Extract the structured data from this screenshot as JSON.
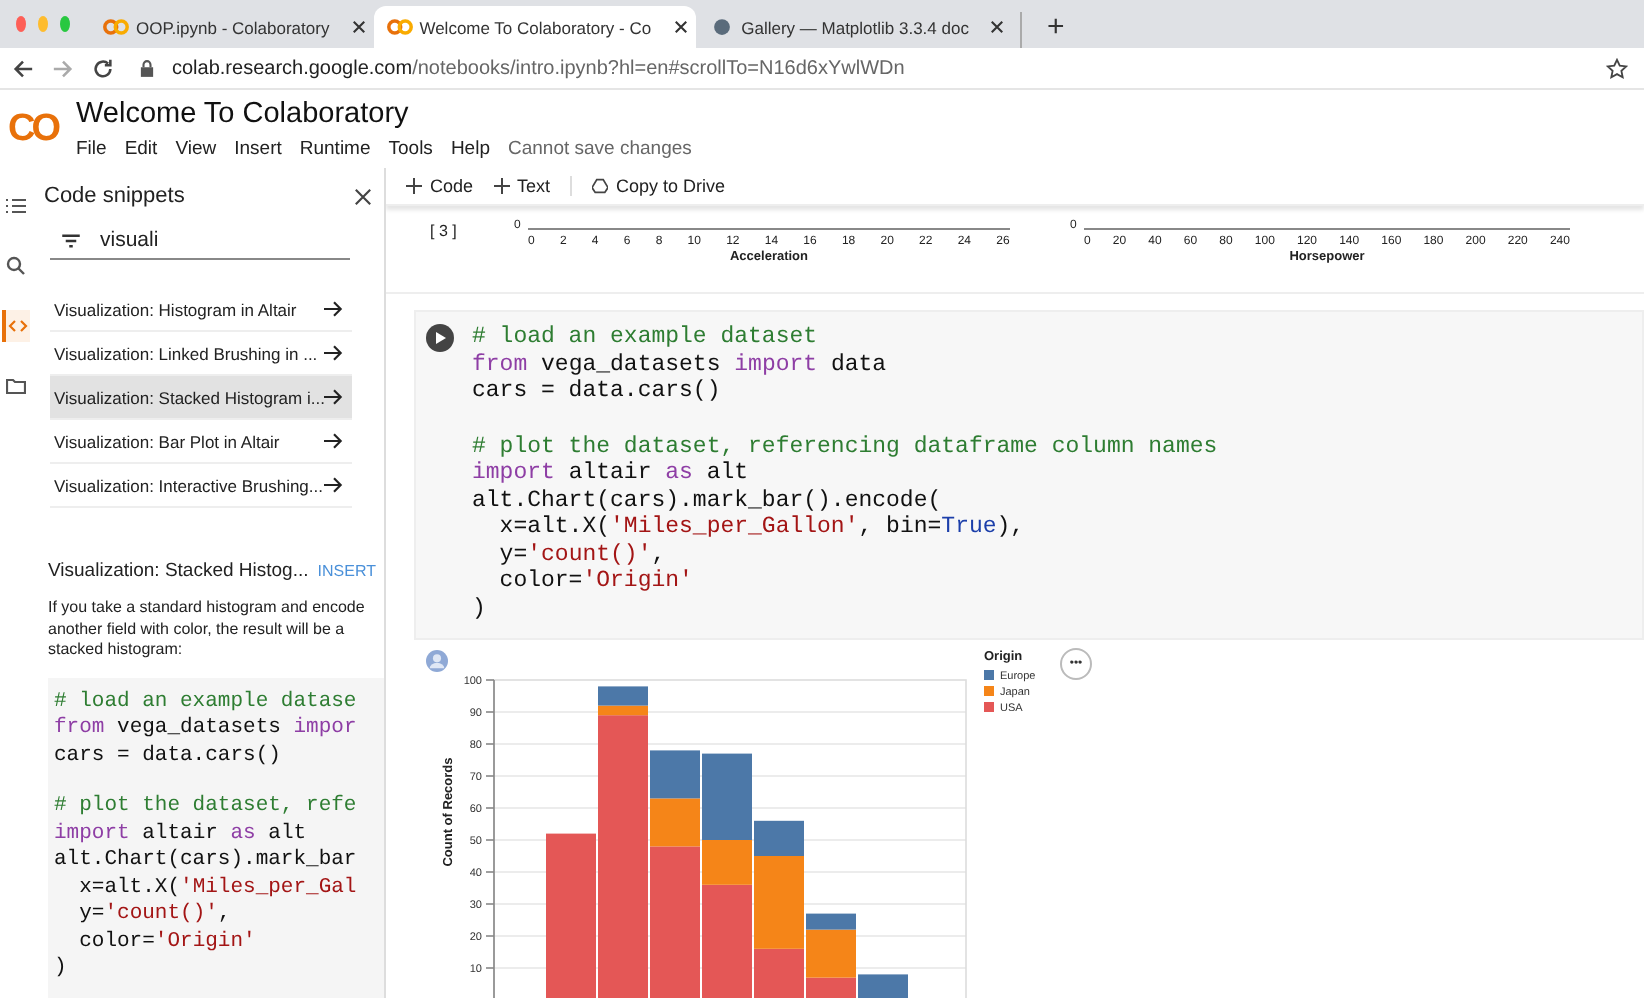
{
  "browser": {
    "tabs": [
      {
        "title": "OOP.ipynb - Colaboratory",
        "selected": false
      },
      {
        "title": "Welcome To Colaboratory - Co",
        "selected": true
      },
      {
        "title": "Gallery — Matplotlib 3.3.4 doc",
        "selected": false
      }
    ],
    "new_tab": "+",
    "address": {
      "host": "colab.research.google.com",
      "path": "/notebooks/intro.ipynb?hl=en#scrollTo=N16d6xYwlWDn"
    }
  },
  "app": {
    "logo": "CO",
    "title": "Welcome To Colaboratory",
    "menu": [
      "File",
      "Edit",
      "View",
      "Insert",
      "Runtime",
      "Tools",
      "Help"
    ],
    "status": "Cannot save changes"
  },
  "rail": [
    {
      "kind": "list",
      "selected": false
    },
    {
      "kind": "search",
      "selected": false
    },
    {
      "kind": "code",
      "selected": true
    },
    {
      "kind": "folder",
      "selected": false
    }
  ],
  "sidebar": {
    "title": "Code snippets",
    "filter": "visuali",
    "results": [
      {
        "label": "Visualization: Histogram in Altair",
        "selected": false
      },
      {
        "label": "Visualization: Linked Brushing in ...",
        "selected": false
      },
      {
        "label": "Visualization: Stacked Histogram i...",
        "selected": true
      },
      {
        "label": "Visualization: Bar Plot in Altair",
        "selected": false
      },
      {
        "label": "Visualization: Interactive Brushing...",
        "selected": false
      }
    ],
    "snippet": {
      "title": "Visualization: Stacked Histog...",
      "action": "INSERT",
      "description": "If you take a standard histogram and encode another field with color, the result will be a stacked histogram:",
      "code": [
        [
          [
            {
              "t": "# load an example datase",
              "kind": "comment"
            }
          ],
          [
            {
              "t": "from",
              "kind": "keyword"
            },
            {
              "t": " vega_datasets ",
              "kind": "plain"
            },
            {
              "t": "impor",
              "kind": "keyword"
            }
          ],
          [
            {
              "t": "cars = data.cars()",
              "kind": "plain"
            }
          ]
        ],
        [
          [
            {
              "t": "# plot the dataset, refe",
              "kind": "comment"
            }
          ],
          [
            {
              "t": "import",
              "kind": "keyword"
            },
            {
              "t": " altair ",
              "kind": "plain"
            },
            {
              "t": "as",
              "kind": "keyword"
            },
            {
              "t": " alt",
              "kind": "plain"
            }
          ],
          [
            {
              "t": "alt.Chart(cars).mark_bar",
              "kind": "plain"
            }
          ],
          [
            {
              "t": "  x=alt.X(",
              "kind": "plain"
            },
            {
              "t": "'Miles_per_Gal",
              "kind": "string"
            }
          ],
          [
            {
              "t": "  y=",
              "kind": "plain"
            },
            {
              "t": "'count()'",
              "kind": "string"
            },
            {
              "t": ",",
              "kind": "plain"
            }
          ],
          [
            {
              "t": "  color=",
              "kind": "plain"
            },
            {
              "t": "'Origin'",
              "kind": "string"
            }
          ],
          [
            {
              "t": ")",
              "kind": "plain"
            }
          ]
        ]
      ]
    }
  },
  "toolbar": [
    {
      "kind": "add",
      "label": "Code"
    },
    {
      "kind": "add",
      "label": "Text"
    },
    {
      "kind": "drive",
      "label": "Copy to Drive"
    }
  ],
  "previous_output": {
    "execution_count": "[ 3 ]",
    "axes": [
      {
        "zero": "0",
        "ticks": [
          "0",
          "2",
          "4",
          "6",
          "8",
          "10",
          "12",
          "14",
          "16",
          "18",
          "20",
          "22",
          "24",
          "26"
        ],
        "title": "Acceleration"
      },
      {
        "zero": "0",
        "ticks": [
          "0",
          "20",
          "40",
          "60",
          "80",
          "100",
          "120",
          "140",
          "160",
          "180",
          "200",
          "220",
          "240"
        ],
        "title": "Horsepower"
      }
    ]
  },
  "code_cell": {
    "code": [
      [
        [
          {
            "t": "# load an example dataset",
            "kind": "comment"
          }
        ],
        [
          {
            "t": "from",
            "kind": "keyword"
          },
          {
            "t": " vega_datasets ",
            "kind": "plain"
          },
          {
            "t": "import",
            "kind": "keyword"
          },
          {
            "t": " data",
            "kind": "plain"
          }
        ],
        [
          {
            "t": "cars = data.cars()",
            "kind": "plain"
          }
        ]
      ],
      [
        [
          {
            "t": "# plot the dataset, referencing dataframe column names",
            "kind": "comment"
          }
        ],
        [
          {
            "t": "import",
            "kind": "keyword"
          },
          {
            "t": " altair ",
            "kind": "plain"
          },
          {
            "t": "as",
            "kind": "keyword"
          },
          {
            "t": " alt",
            "kind": "plain"
          }
        ],
        [
          {
            "t": "alt.Chart(cars).mark_bar().encode(",
            "kind": "plain"
          }
        ],
        [
          {
            "t": "  x=alt.X(",
            "kind": "plain"
          },
          {
            "t": "'Miles_per_Gallon'",
            "kind": "string"
          },
          {
            "t": ", bin=",
            "kind": "plain"
          },
          {
            "t": "True",
            "kind": "constant"
          },
          {
            "t": "),",
            "kind": "plain"
          }
        ],
        [
          {
            "t": "  y=",
            "kind": "plain"
          },
          {
            "t": "'count()'",
            "kind": "string"
          },
          {
            "t": ",",
            "kind": "plain"
          }
        ],
        [
          {
            "t": "  color=",
            "kind": "plain"
          },
          {
            "t": "'Origin'",
            "kind": "string"
          }
        ],
        [
          {
            "t": ")",
            "kind": "plain"
          }
        ]
      ]
    ]
  },
  "output": {
    "more": "•••",
    "chart_data": {
      "type": "bar",
      "stacked": true,
      "ylabel": "Count of Records",
      "ylim": [
        0,
        100
      ],
      "yticks": [
        10,
        20,
        30,
        40,
        50,
        60,
        70,
        80,
        90,
        100
      ],
      "series": [
        {
          "name": "USA",
          "color": "#e45756",
          "values": [
            52,
            89,
            48,
            36,
            16,
            7,
            0
          ]
        },
        {
          "name": "Japan",
          "color": "#f58518",
          "values": [
            0,
            3,
            15,
            14,
            29,
            15,
            0
          ]
        },
        {
          "name": "Europe",
          "color": "#4c78a8",
          "values": [
            0,
            6,
            15,
            27,
            11,
            5,
            8
          ]
        }
      ],
      "grid": true,
      "legend": {
        "title": "Origin"
      }
    }
  }
}
